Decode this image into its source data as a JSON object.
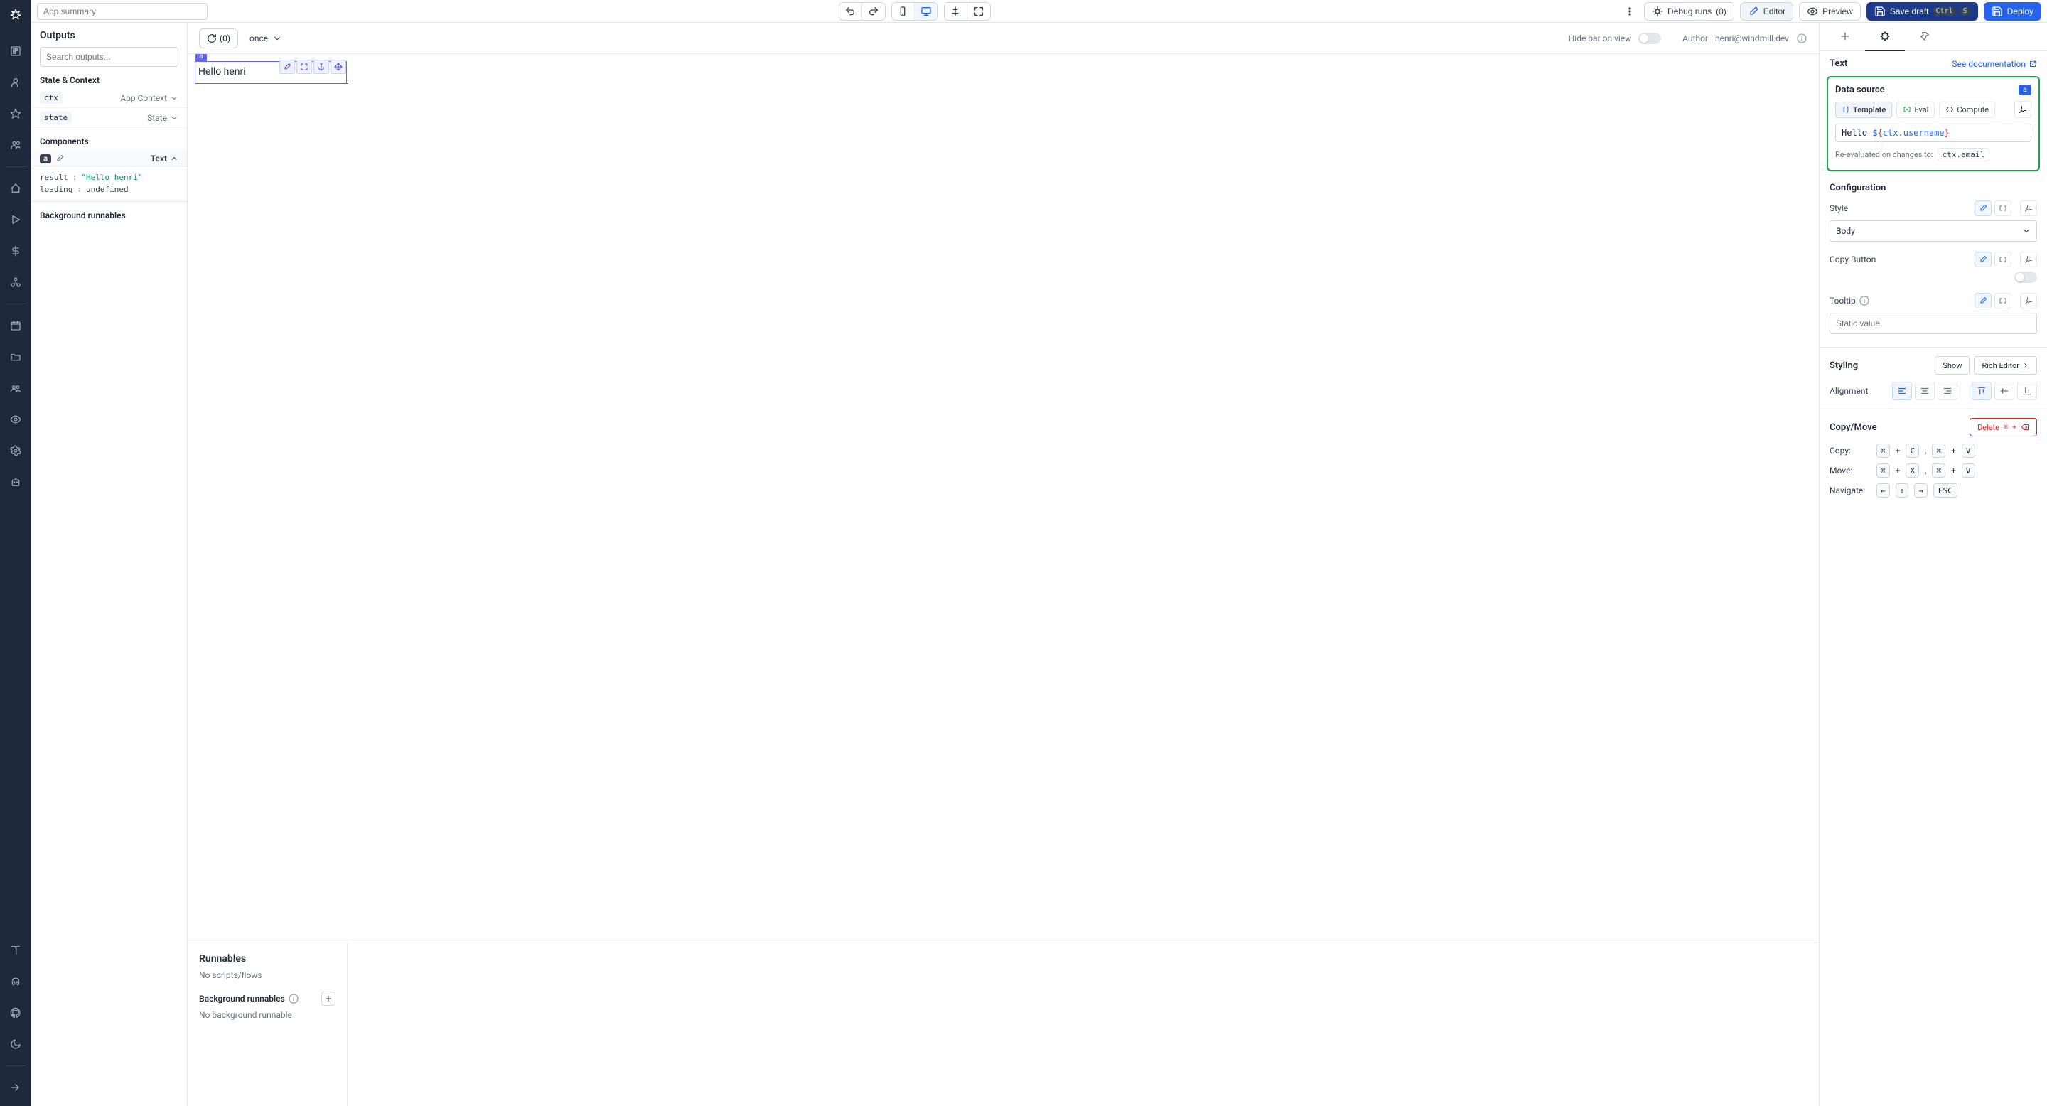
{
  "topbar": {
    "app_summary_placeholder": "App summary",
    "debug_runs": "Debug runs",
    "debug_runs_count": "(0)",
    "editor": "Editor",
    "preview": "Preview",
    "save_draft": "Save draft",
    "save_draft_kbd1": "Ctrl",
    "save_draft_kbd2": "S",
    "deploy": "Deploy"
  },
  "outputs": {
    "title": "Outputs",
    "search_placeholder": "Search outputs...",
    "state_context_label": "State & Context",
    "ctx_badge": "ctx",
    "ctx_type": "App Context",
    "state_badge": "state",
    "state_type": "State",
    "components_label": "Components",
    "comp_a_id": "a",
    "comp_a_type": "Text",
    "result_key": "result",
    "result_val": "\"Hello henri\"",
    "loading_key": "loading",
    "loading_val": "undefined",
    "bg_runnables_label": "Background runnables"
  },
  "canvas": {
    "refresh_count": "(0)",
    "once": "once",
    "hide_bar": "Hide bar on view",
    "author_label": "Author",
    "author_email": "henri@windmill.dev",
    "component_id": "a",
    "component_text": "Hello henri"
  },
  "runnables": {
    "title": "Runnables",
    "no_scripts": "No scripts/flows",
    "bg_title": "Background runnables",
    "no_bg": "No background runnable"
  },
  "props": {
    "header_title": "Text",
    "doc_link": "See documentation",
    "data_source": {
      "title": "Data source",
      "comp_id": "a",
      "mode_template": "Template",
      "mode_eval": "Eval",
      "mode_compute": "Compute",
      "expr_prefix": "Hello ",
      "expr_dollar": "$",
      "expr_open": "{",
      "expr_body": "ctx.username",
      "expr_close": "}",
      "reeval_label": "Re-evaluated on changes to:",
      "reeval_dep": "ctx.email"
    },
    "configuration": {
      "title": "Configuration",
      "style_label": "Style",
      "style_value": "Body",
      "copy_button_label": "Copy Button",
      "tooltip_label": "Tooltip",
      "tooltip_placeholder": "Static value"
    },
    "styling": {
      "title": "Styling",
      "show": "Show",
      "rich_editor": "Rich Editor",
      "alignment_label": "Alignment"
    },
    "copymove": {
      "title": "Copy/Move",
      "delete": "Delete",
      "delete_kbd": "⌘ +",
      "copy_label": "Copy:",
      "move_label": "Move:",
      "navigate_label": "Navigate:",
      "cmd": "⌘",
      "plus": "+",
      "c": "C",
      "v": "V",
      "x": "X",
      "comma": ",",
      "left": "←",
      "up": "↑",
      "right": "→",
      "esc": "ESC"
    }
  }
}
